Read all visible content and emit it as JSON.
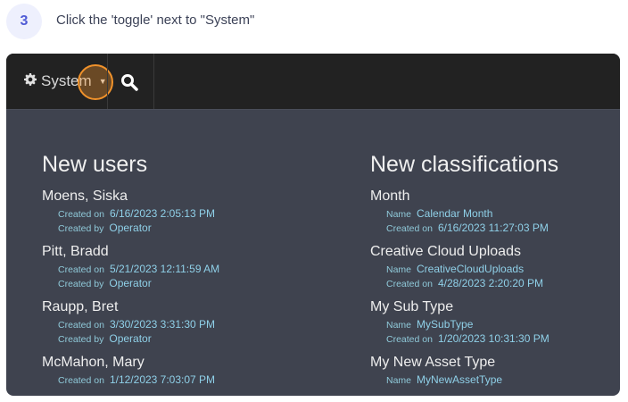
{
  "step": {
    "number": "3",
    "instruction": "Click the 'toggle' next to \"System\""
  },
  "topbar": {
    "menu_label": "System"
  },
  "users": {
    "title": "New users",
    "items": [
      {
        "name": "Moens, Siska",
        "rows": [
          {
            "label": "Created on",
            "value": "6/16/2023 2:05:13 PM"
          },
          {
            "label": "Created by",
            "value": "Operator"
          }
        ]
      },
      {
        "name": "Pitt, Bradd",
        "rows": [
          {
            "label": "Created on",
            "value": "5/21/2023 12:11:59 AM"
          },
          {
            "label": "Created by",
            "value": "Operator"
          }
        ]
      },
      {
        "name": "Raupp, Bret",
        "rows": [
          {
            "label": "Created on",
            "value": "3/30/2023 3:31:30 PM"
          },
          {
            "label": "Created by",
            "value": "Operator"
          }
        ]
      },
      {
        "name": "McMahon, Mary",
        "rows": [
          {
            "label": "Created on",
            "value": "1/12/2023 7:03:07 PM"
          }
        ]
      }
    ]
  },
  "classifications": {
    "title": "New classifications",
    "items": [
      {
        "name": "Month",
        "rows": [
          {
            "label": "Name",
            "value": "Calendar Month"
          },
          {
            "label": "Created on",
            "value": "6/16/2023 11:27:03 PM"
          }
        ]
      },
      {
        "name": "Creative Cloud Uploads",
        "rows": [
          {
            "label": "Name",
            "value": "CreativeCloudUploads"
          },
          {
            "label": "Created on",
            "value": "4/28/2023 2:20:20 PM"
          }
        ]
      },
      {
        "name": "My Sub Type",
        "rows": [
          {
            "label": "Name",
            "value": "MySubType"
          },
          {
            "label": "Created on",
            "value": "1/20/2023 10:31:30 PM"
          }
        ]
      },
      {
        "name": "My New Asset Type",
        "rows": [
          {
            "label": "Name",
            "value": "MyNewAssetType"
          }
        ]
      }
    ]
  }
}
